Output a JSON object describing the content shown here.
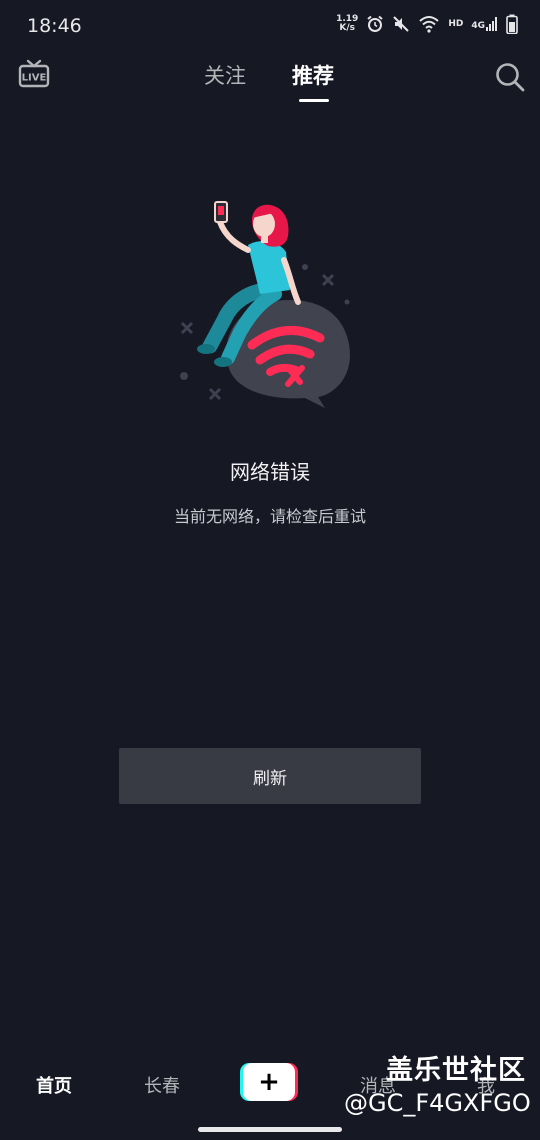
{
  "status_bar": {
    "time": "18:46",
    "net_speed_value": "1.19",
    "net_speed_unit": "K/s",
    "hd_label": "HD",
    "network_label": "4G"
  },
  "top_nav": {
    "live_label": "LIVE",
    "tabs": [
      {
        "label": "关注",
        "active": false
      },
      {
        "label": "推荐",
        "active": true
      }
    ]
  },
  "error": {
    "title": "网络错误",
    "subtitle": "当前无网络，请检查后重试"
  },
  "refresh_label": "刷新",
  "bottom_nav": {
    "items": [
      {
        "label": "首页",
        "active": true
      },
      {
        "label": "长春",
        "active": false
      },
      {
        "label": "消息",
        "active": false
      },
      {
        "label": "我",
        "active": false
      }
    ],
    "add_symbol": "+"
  },
  "watermark": {
    "title": "盖乐世社区",
    "id": "@GC_F4GXFGO"
  },
  "colors": {
    "background": "#161823",
    "accent_red": "#fe2c55",
    "accent_cyan": "#25f4ee",
    "button_bg": "#393b44"
  }
}
